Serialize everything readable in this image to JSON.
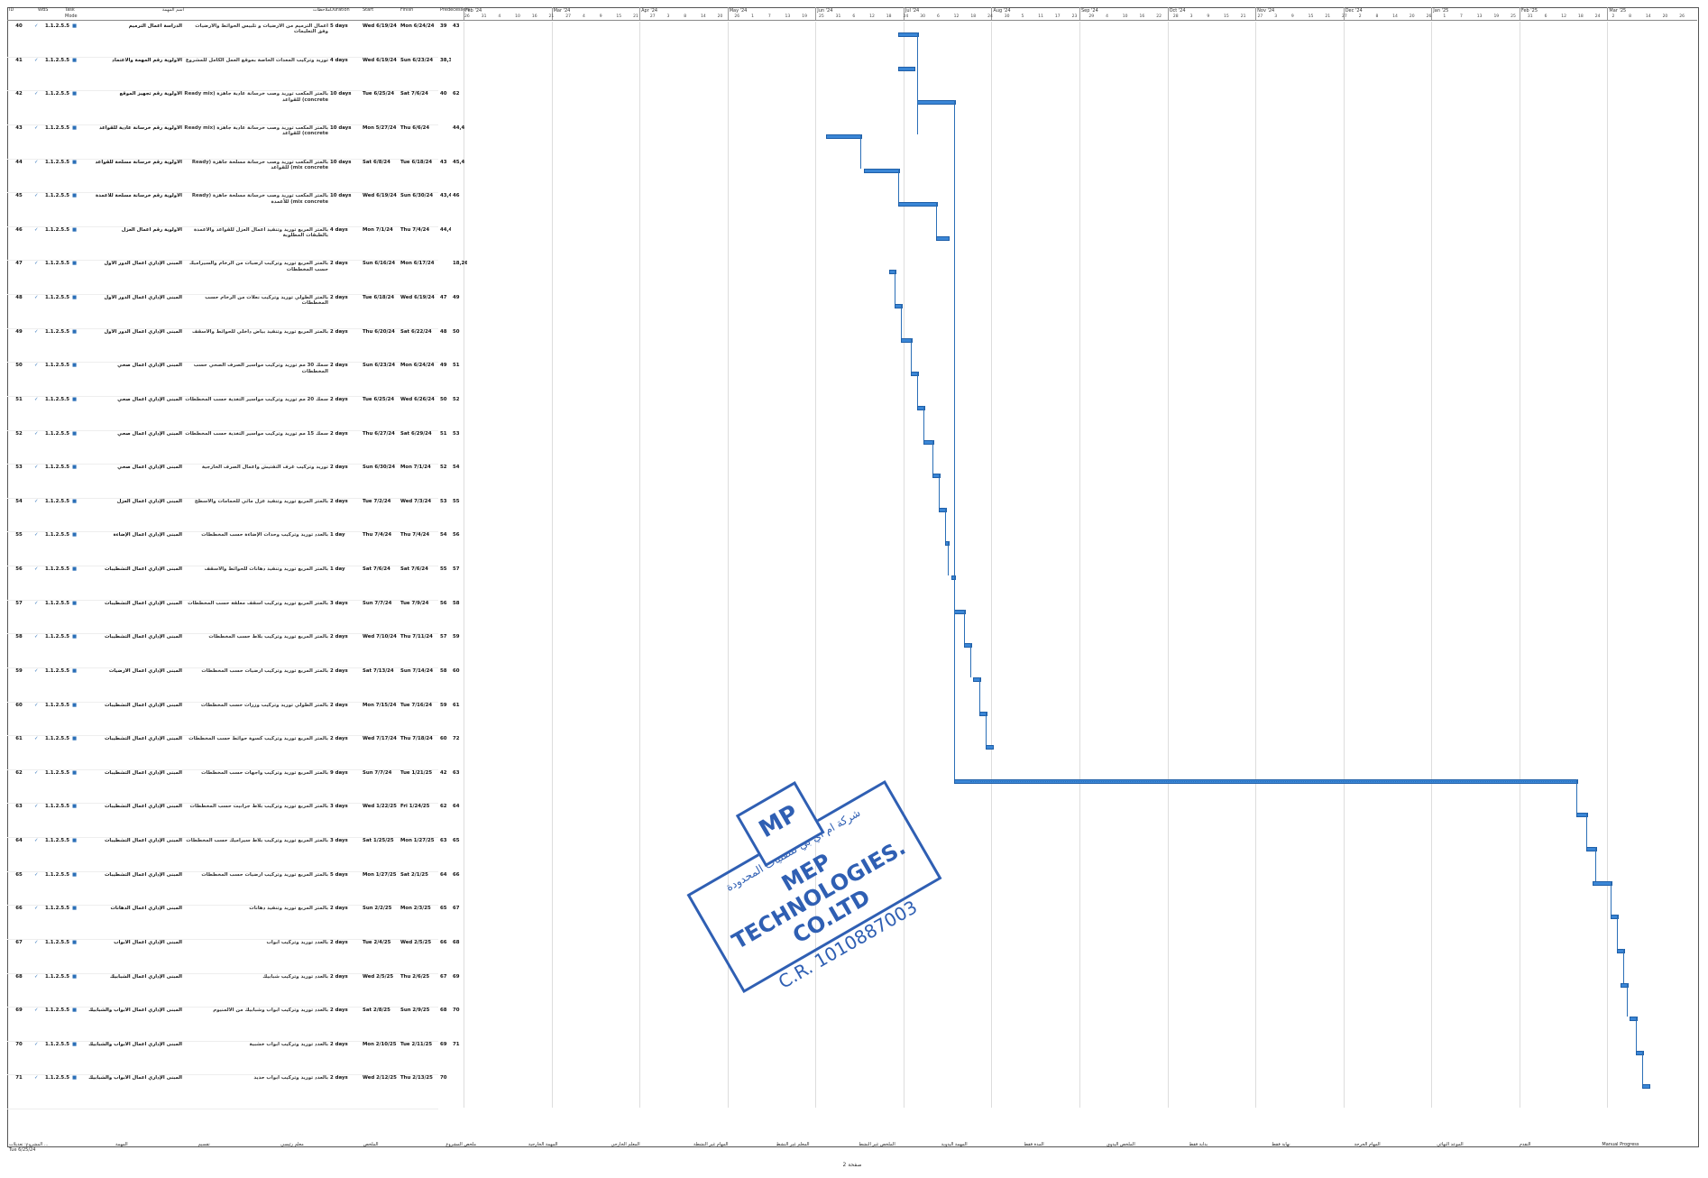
{
  "header": {
    "id": "ID",
    "wbs": "WBS",
    "mode": "Task Mode",
    "name": "اسم المهمة",
    "notes": "ملاحظات",
    "duration": "Duration",
    "start": "Start",
    "finish": "Finish",
    "pred": "Predecessors",
    "succ": "Successors"
  },
  "timeline": {
    "months": [
      {
        "label": "Feb '24"
      },
      {
        "label": "Mar '24"
      },
      {
        "label": "Apr '24"
      },
      {
        "label": "May '24"
      },
      {
        "label": "Jun '24"
      },
      {
        "label": "Jul '24"
      },
      {
        "label": "Aug '24"
      },
      {
        "label": "Sep '24"
      },
      {
        "label": "Oct '24"
      },
      {
        "label": "Nov '24"
      },
      {
        "label": "Dec '24"
      },
      {
        "label": "Jan '25"
      },
      {
        "label": "Feb '25"
      },
      {
        "label": "Mar '25"
      }
    ],
    "days": [
      "26",
      "31",
      "4",
      "10",
      "16",
      "21",
      "27",
      "4",
      "9",
      "15",
      "21",
      "27",
      "3",
      "8",
      "14",
      "20",
      "26",
      "1",
      "7",
      "13",
      "19",
      "25",
      "31",
      "6",
      "12",
      "18",
      "24",
      "30",
      "6",
      "12",
      "18",
      "24",
      "30",
      "5",
      "11",
      "17",
      "23",
      "29",
      "4",
      "10",
      "16",
      "22",
      "28",
      "3",
      "9",
      "15",
      "21",
      "27",
      "3",
      "9",
      "15",
      "21",
      "27",
      "2",
      "8",
      "14",
      "20",
      "26",
      "1",
      "7",
      "13",
      "19",
      "25",
      "31",
      "6",
      "12",
      "18",
      "24",
      "2",
      "8",
      "14",
      "20",
      "26"
    ]
  },
  "tasks": [
    {
      "id": "40",
      "wbs": "1.1.2.5.5",
      "name": "الدراسة أعمال الترميم",
      "notes": "أعمال الترميم من الأرضيات و تلبيس الحوائط والأرضيات وفق التعليمات",
      "dur": "5 days",
      "start": "Wed 6/19/24",
      "finish": "Mon 6/24/24",
      "pred": "39",
      "succ": "43"
    },
    {
      "id": "41",
      "wbs": "1.1.2.5.5",
      "name": "الأولوية رقم المهمة والاعتماد",
      "notes": "توريد وتركيب المعدات الخاصة بموقع العمل الكامل للمشروع",
      "dur": "4 days",
      "start": "Wed 6/19/24",
      "finish": "Sun 6/23/24",
      "pred": "38,39",
      "succ": ""
    },
    {
      "id": "42",
      "wbs": "1.1.2.5.5",
      "name": "الأولوية رقم تجهيز الموقع",
      "notes": "بالمتر المكعب توريد وصب خرسانة عادية جاهزة (Ready mix concrete) للقواعد",
      "dur": "10 days",
      "start": "Tue 6/25/24",
      "finish": "Sat 7/6/24",
      "pred": "40",
      "succ": "62"
    },
    {
      "id": "43",
      "wbs": "1.1.2.5.5",
      "name": "الأولوية رقم خرسانة عادية للقواعد",
      "notes": "بالمتر المكعب توريد وصب خرسانة عادية جاهزة (Ready mix concrete) للقواعد",
      "dur": "10 days",
      "start": "Mon 5/27/24",
      "finish": "Thu 6/6/24",
      "pred": "",
      "succ": "44,4"
    },
    {
      "id": "44",
      "wbs": "1.1.2.5.5",
      "name": "الأولوية رقم خرسانة مسلحة للقواعد",
      "notes": "بالمتر المكعب توريد وصب خرسانة مسلحة جاهزة (Ready mix concrete) للقواعد",
      "dur": "10 days",
      "start": "Sat 6/8/24",
      "finish": "Tue 6/18/24",
      "pred": "43",
      "succ": "45,4"
    },
    {
      "id": "45",
      "wbs": "1.1.2.5.5",
      "name": "الأولوية رقم خرسانة مسلحة للأعمدة",
      "notes": "بالمتر المكعب توريد وصب خرسانة مسلحة جاهزة (Ready mix concrete) للأعمدة",
      "dur": "10 days",
      "start": "Wed 6/19/24",
      "finish": "Sun 6/30/24",
      "pred": "43,44",
      "succ": "46"
    },
    {
      "id": "46",
      "wbs": "1.1.2.5.5",
      "name": "الأولوية رقم أعمال العزل",
      "notes": "بالمتر المربع توريد وتنفيذ أعمال العزل للقواعد والأعمدة بالطبقات المطلوبة",
      "dur": "4 days",
      "start": "Mon 7/1/24",
      "finish": "Thu 7/4/24",
      "pred": "44,45",
      "succ": ""
    },
    {
      "id": "47",
      "wbs": "1.1.2.5.5",
      "name": "المبنى الإداري أعمال الدور الأول",
      "notes": "بالمتر المربع توريد وتركيب أرضيات من الرخام والسيراميك حسب المخططات",
      "dur": "2 days",
      "start": "Sun 6/16/24",
      "finish": "Mon 6/17/24",
      "pred": "",
      "succ": "18,26,48"
    },
    {
      "id": "48",
      "wbs": "1.1.2.5.5",
      "name": "المبنى الإداري أعمال الدور الأول",
      "notes": "بالمتر الطولي توريد وتركيب نعلات من الرخام حسب المخططات",
      "dur": "2 days",
      "start": "Tue 6/18/24",
      "finish": "Wed 6/19/24",
      "pred": "47",
      "succ": "49"
    },
    {
      "id": "49",
      "wbs": "1.1.2.5.5",
      "name": "المبنى الإداري أعمال الدور الأول",
      "notes": "بالمتر المربع توريد وتنفيذ بياض داخلي للحوائط والأسقف",
      "dur": "2 days",
      "start": "Thu 6/20/24",
      "finish": "Sat 6/22/24",
      "pred": "48",
      "succ": "50"
    },
    {
      "id": "50",
      "wbs": "1.1.2.5.5",
      "name": "المبنى الإداري أعمال صحي",
      "notes": "سمك 30 مم توريد وتركيب مواسير الصرف الصحي حسب المخططات",
      "dur": "2 days",
      "start": "Sun 6/23/24",
      "finish": "Mon 6/24/24",
      "pred": "49",
      "succ": "51"
    },
    {
      "id": "51",
      "wbs": "1.1.2.5.5",
      "name": "المبنى الإداري أعمال صحي",
      "notes": "سمك 20 مم توريد وتركيب مواسير التغذية حسب المخططات",
      "dur": "2 days",
      "start": "Tue 6/25/24",
      "finish": "Wed 6/26/24",
      "pred": "50",
      "succ": "52"
    },
    {
      "id": "52",
      "wbs": "1.1.2.5.5",
      "name": "المبنى الإداري أعمال صحي",
      "notes": "سمك 15 مم توريد وتركيب مواسير التغذية حسب المخططات",
      "dur": "2 days",
      "start": "Thu 6/27/24",
      "finish": "Sat 6/29/24",
      "pred": "51",
      "succ": "53"
    },
    {
      "id": "53",
      "wbs": "1.1.2.5.5",
      "name": "المبنى الإداري أعمال صحي",
      "notes": "توريد وتركيب غرف التفتيش وأعمال الصرف الخارجية",
      "dur": "2 days",
      "start": "Sun 6/30/24",
      "finish": "Mon 7/1/24",
      "pred": "52",
      "succ": "54"
    },
    {
      "id": "54",
      "wbs": "1.1.2.5.5",
      "name": "المبنى الإداري أعمال العزل",
      "notes": "بالمتر المربع توريد وتنفيذ عزل مائي للحمامات والأسطح",
      "dur": "2 days",
      "start": "Tue 7/2/24",
      "finish": "Wed 7/3/24",
      "pred": "53",
      "succ": "55"
    },
    {
      "id": "55",
      "wbs": "1.1.2.5.5",
      "name": "المبنى الإداري أعمال الإضاءة",
      "notes": "بالعدد توريد وتركيب وحدات الإضاءة حسب المخططات",
      "dur": "1 day",
      "start": "Thu 7/4/24",
      "finish": "Thu 7/4/24",
      "pred": "54",
      "succ": "56"
    },
    {
      "id": "56",
      "wbs": "1.1.2.5.5",
      "name": "المبنى الإداري أعمال التشطيبات",
      "notes": "بالمتر المربع توريد وتنفيذ دهانات للحوائط والأسقف",
      "dur": "1 day",
      "start": "Sat 7/6/24",
      "finish": "Sat 7/6/24",
      "pred": "55",
      "succ": "57"
    },
    {
      "id": "57",
      "wbs": "1.1.2.5.5",
      "name": "المبنى الإداري أعمال التشطيبات",
      "notes": "بالمتر المربع توريد وتركيب أسقف معلقة حسب المخططات",
      "dur": "3 days",
      "start": "Sun 7/7/24",
      "finish": "Tue 7/9/24",
      "pred": "56",
      "succ": "58"
    },
    {
      "id": "58",
      "wbs": "1.1.2.5.5",
      "name": "المبنى الإداري أعمال التشطيبات",
      "notes": "بالمتر المربع توريد وتركيب بلاط حسب المخططات",
      "dur": "2 days",
      "start": "Wed 7/10/24",
      "finish": "Thu 7/11/24",
      "pred": "57",
      "succ": "59"
    },
    {
      "id": "59",
      "wbs": "1.1.2.5.5",
      "name": "المبنى الإداري أعمال الأرضيات",
      "notes": "بالمتر المربع توريد وتركيب أرضيات حسب المخططات",
      "dur": "2 days",
      "start": "Sat 7/13/24",
      "finish": "Sun 7/14/24",
      "pred": "58",
      "succ": "60"
    },
    {
      "id": "60",
      "wbs": "1.1.2.5.5",
      "name": "المبنى الإداري أعمال التشطيبات",
      "notes": "بالمتر الطولي توريد وتركيب وزرات حسب المخططات",
      "dur": "2 days",
      "start": "Mon 7/15/24",
      "finish": "Tue 7/16/24",
      "pred": "59",
      "succ": "61"
    },
    {
      "id": "61",
      "wbs": "1.1.2.5.5",
      "name": "المبنى الإداري أعمال التشطيبات",
      "notes": "بالمتر المربع توريد وتركيب كسوة حوائط حسب المخططات",
      "dur": "2 days",
      "start": "Wed 7/17/24",
      "finish": "Thu 7/18/24",
      "pred": "60",
      "succ": "72"
    },
    {
      "id": "62",
      "wbs": "1.1.2.5.5",
      "name": "المبنى الإداري أعمال التشطيبات",
      "notes": "بالمتر المربع توريد وتركيب واجهات حسب المخططات",
      "dur": "9 days",
      "start": "Sun 7/7/24",
      "finish": "Tue 1/21/25",
      "pred": "42",
      "succ": "63"
    },
    {
      "id": "63",
      "wbs": "1.1.2.5.5",
      "name": "المبنى الإداري أعمال التشطيبات",
      "notes": "بالمتر المربع توريد وتركيب بلاط جرانيت حسب المخططات",
      "dur": "3 days",
      "start": "Wed 1/22/25",
      "finish": "Fri 1/24/25",
      "pred": "62",
      "succ": "64"
    },
    {
      "id": "64",
      "wbs": "1.1.2.5.5",
      "name": "المبنى الإداري أعمال التشطيبات",
      "notes": "بالمتر المربع توريد وتركيب بلاط سيراميك حسب المخططات",
      "dur": "3 days",
      "start": "Sat 1/25/25",
      "finish": "Mon 1/27/25",
      "pred": "63",
      "succ": "65"
    },
    {
      "id": "65",
      "wbs": "1.1.2.5.5",
      "name": "المبنى الإداري أعمال التشطيبات",
      "notes": "بالمتر المربع توريد وتركيب أرضيات حسب المخططات",
      "dur": "5 days",
      "start": "Mon 1/27/25",
      "finish": "Sat 2/1/25",
      "pred": "64",
      "succ": "66"
    },
    {
      "id": "66",
      "wbs": "1.1.2.5.5",
      "name": "المبنى الإداري أعمال الدهانات",
      "notes": "بالمتر المربع توريد وتنفيذ دهانات",
      "dur": "2 days",
      "start": "Sun 2/2/25",
      "finish": "Mon 2/3/25",
      "pred": "65",
      "succ": "67"
    },
    {
      "id": "67",
      "wbs": "1.1.2.5.5",
      "name": "المبنى الإداري أعمال الأبواب",
      "notes": "بالعدد توريد وتركيب أبواب",
      "dur": "2 days",
      "start": "Tue 2/4/25",
      "finish": "Wed 2/5/25",
      "pred": "66",
      "succ": "68"
    },
    {
      "id": "68",
      "wbs": "1.1.2.5.5",
      "name": "المبنى الإداري أعمال الشبابيك",
      "notes": "بالعدد توريد وتركيب شبابيك",
      "dur": "2 days",
      "start": "Wed 2/5/25",
      "finish": "Thu 2/6/25",
      "pred": "67",
      "succ": "69"
    },
    {
      "id": "69",
      "wbs": "1.1.2.5.5",
      "name": "المبنى الإداري أعمال الأبواب والشبابيك",
      "notes": "بالعدد توريد وتركيب أبواب وشبابيك من الألمنيوم",
      "dur": "2 days",
      "start": "Sat 2/8/25",
      "finish": "Sun 2/9/25",
      "pred": "68",
      "succ": "70"
    },
    {
      "id": "70",
      "wbs": "1.1.2.5.5",
      "name": "المبنى الإداري أعمال الأبواب والشبابيك",
      "notes": "بالعدد توريد وتركيب أبواب خشبية",
      "dur": "2 days",
      "start": "Mon 2/10/25",
      "finish": "Tue 2/11/25",
      "pred": "69",
      "succ": "71"
    },
    {
      "id": "71",
      "wbs": "1.1.2.5.5",
      "name": "المبنى الإداري أعمال الأبواب والشبابيك",
      "notes": "بالعدد توريد وتركيب أبواب حديد",
      "dur": "2 days",
      "start": "Wed 2/12/25",
      "finish": "Thu 2/13/25",
      "pred": "70",
      "succ": ""
    }
  ],
  "stamp": {
    "company_ar": "شركة ام اي بي للتقنيات المحدودة",
    "company_en": "MEP TECHNOLOGIES. CO.LTD",
    "cr": "C.R. 1010887003",
    "logo": "MP"
  },
  "legend": {
    "items": [
      "المهمة",
      "تقسيم",
      "معلم رئيسي",
      "الملخص",
      "ملخص المشروع",
      "المهمة الخارجية",
      "المعلم الخارجي",
      "المهام غير النشطة",
      "المعلم غير النشط",
      "الملخص غير النشط",
      "المهمة اليدوية",
      "المدة فقط",
      "الملخص اليدوي",
      "بداية فقط",
      "نهاية فقط",
      "المهام الحرجة",
      "الموعد النهائي",
      "التقدم",
      "Manual Progress"
    ]
  },
  "footer": {
    "page": "صفحة 2"
  },
  "project_box": {
    "line1": "المشروع: تعديلات ...",
    "line2": "Tue 6/25/24"
  }
}
